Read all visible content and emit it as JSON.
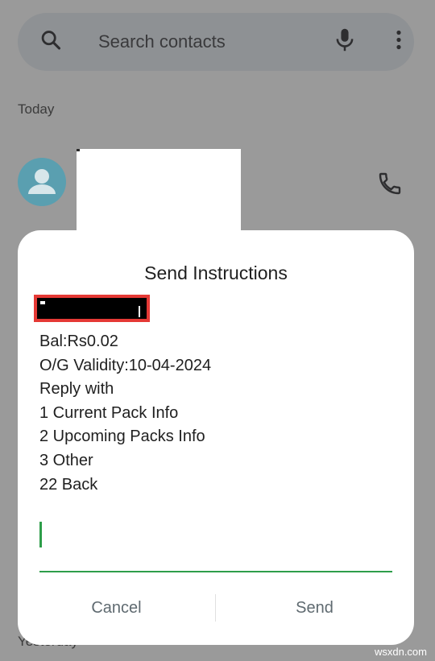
{
  "search": {
    "placeholder": "Search contacts"
  },
  "conversations": {
    "section_today": "Today",
    "section_yesterday": "Yesterday"
  },
  "dialog": {
    "title": "Send Instructions",
    "message_lines": [
      "Bal:Rs0.02",
      "O/G Validity:10-04-2024",
      "Reply with",
      "1 Current Pack Info",
      "2 Upcoming Packs Info",
      "3 Other",
      "22 Back"
    ],
    "reply_value": "",
    "buttons": {
      "cancel": "Cancel",
      "send": "Send"
    }
  },
  "colors": {
    "accent_green": "#2e9e4a",
    "redaction_border": "#e53935",
    "avatar": "#5a9fb0"
  },
  "watermark": "wsxdn.com"
}
